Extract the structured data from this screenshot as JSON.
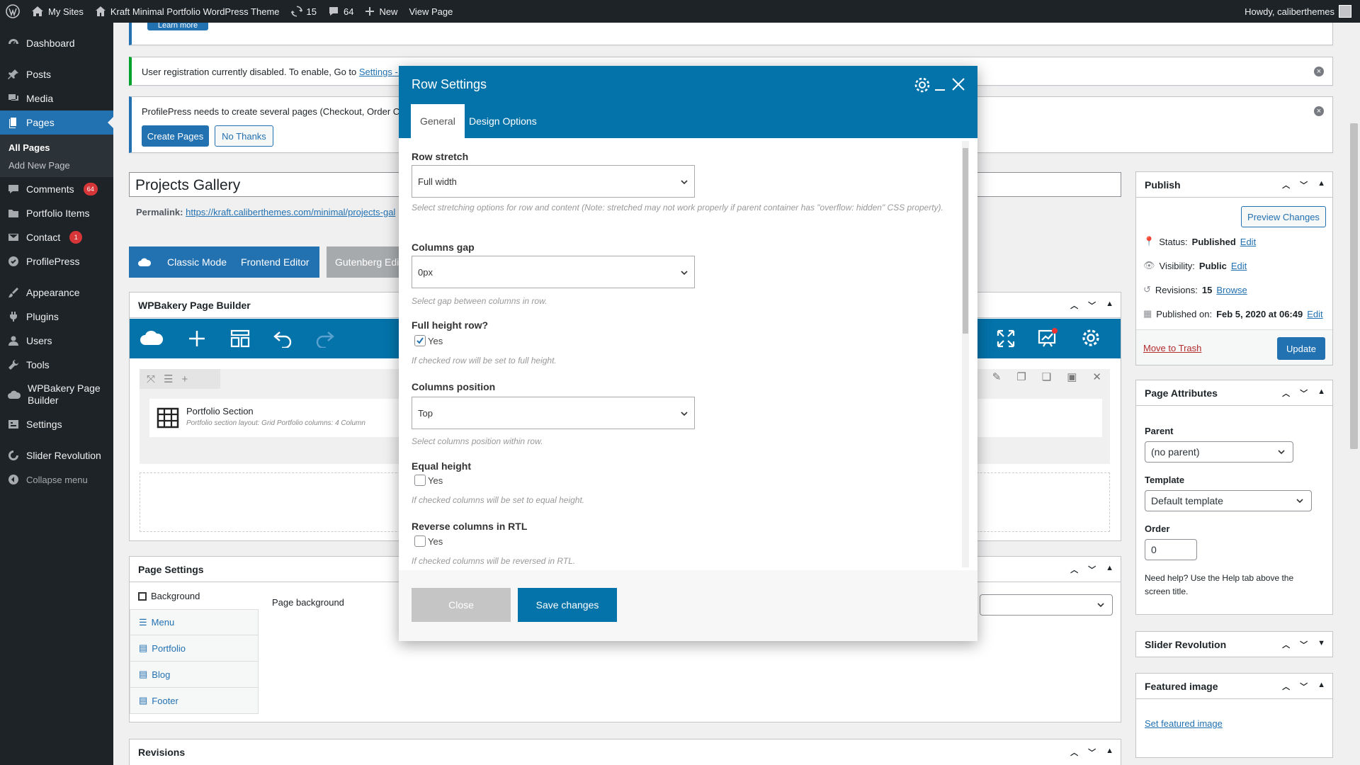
{
  "admin_bar": {
    "my_sites": "My Sites",
    "site_name": "Kraft Minimal Portfolio WordPress Theme",
    "updates": "15",
    "comments": "64",
    "new": "New",
    "view_page": "View Page",
    "howdy": "Howdy, caliberthemes"
  },
  "sidebar": {
    "dashboard": "Dashboard",
    "posts": "Posts",
    "media": "Media",
    "pages": "Pages",
    "all_pages": "All Pages",
    "add_new_page": "Add New Page",
    "comments": "Comments",
    "comments_count": "64",
    "portfolio_items": "Portfolio Items",
    "contact": "Contact",
    "contact_count": "1",
    "profilepress": "ProfilePress",
    "appearance": "Appearance",
    "plugins": "Plugins",
    "users": "Users",
    "tools": "Tools",
    "wpbakery_line1": "WPBakery Page",
    "wpbakery_line2": "Builder",
    "settings": "Settings",
    "slider_revolution": "Slider Revolution",
    "collapse": "Collapse menu"
  },
  "notices": {
    "top_button": "Learn more",
    "registration_text": "User registration currently disabled. To enable, Go to",
    "registration_link": "Settings - G",
    "profilepress_text": "ProfilePress needs to create several pages (Checkout, Order Con",
    "create_pages": "Create Pages",
    "no_thanks": "No Thanks"
  },
  "editor": {
    "title": "Projects Gallery",
    "permalink_label": "Permalink:",
    "permalink_url": "https://kraft.caliberthemes.com/minimal/projects-gal",
    "classic_mode": "Classic Mode",
    "frontend_editor": "Frontend Editor",
    "gutenberg": "Gutenberg Edi"
  },
  "wpbakery": {
    "title": "WPBakery Page Builder",
    "element_title": "Portfolio Section",
    "element_desc": "Portfolio section layout: Grid  Portfolio columns: 4 Column"
  },
  "page_settings": {
    "title": "Page Settings",
    "tabs": [
      "Background",
      "Menu",
      "Portfolio",
      "Blog",
      "Footer"
    ],
    "page_background": "Page background"
  },
  "revisions_box": {
    "title": "Revisions"
  },
  "publish": {
    "title": "Publish",
    "preview": "Preview Changes",
    "status_label": "Status:",
    "status_value": "Published",
    "visibility_label": "Visibility:",
    "visibility_value": "Public",
    "revisions_label": "Revisions:",
    "revisions_value": "15",
    "browse": "Browse",
    "published_label": "Published on:",
    "published_value": "Feb 5, 2020 at 06:49",
    "edit": "Edit",
    "trash": "Move to Trash",
    "update": "Update"
  },
  "page_attributes": {
    "title": "Page Attributes",
    "parent_label": "Parent",
    "parent_value": "(no parent)",
    "template_label": "Template",
    "template_value": "Default template",
    "order_label": "Order",
    "order_value": "0",
    "help": "Need help? Use the Help tab above the screen title."
  },
  "slider_box": {
    "title": "Slider Revolution"
  },
  "featured": {
    "title": "Featured image",
    "link": "Set featured image"
  },
  "modal": {
    "title": "Row Settings",
    "tab_general": "General",
    "tab_design": "Design Options",
    "row_stretch_label": "Row stretch",
    "row_stretch_value": "Full width",
    "row_stretch_desc": "Select stretching options for row and content (Note: stretched may not work properly if parent container has \"overflow: hidden\" CSS property).",
    "columns_gap_label": "Columns gap",
    "columns_gap_value": "0px",
    "columns_gap_desc": "Select gap between columns in row.",
    "full_height_label": "Full height row?",
    "full_height_desc": "If checked row will be set to full height.",
    "columns_position_label": "Columns position",
    "columns_position_value": "Top",
    "columns_position_desc": "Select columns position within row.",
    "equal_height_label": "Equal height",
    "equal_height_desc": "If checked columns will be set to equal height.",
    "reverse_label": "Reverse columns in RTL",
    "reverse_desc": "If checked columns will be reversed in RTL.",
    "yes": "Yes",
    "close": "Close",
    "save": "Save changes"
  },
  "colors": {
    "wp_blue": "#2271b1",
    "vc_blue": "#0473aa",
    "sidebar": "#1d2327"
  }
}
